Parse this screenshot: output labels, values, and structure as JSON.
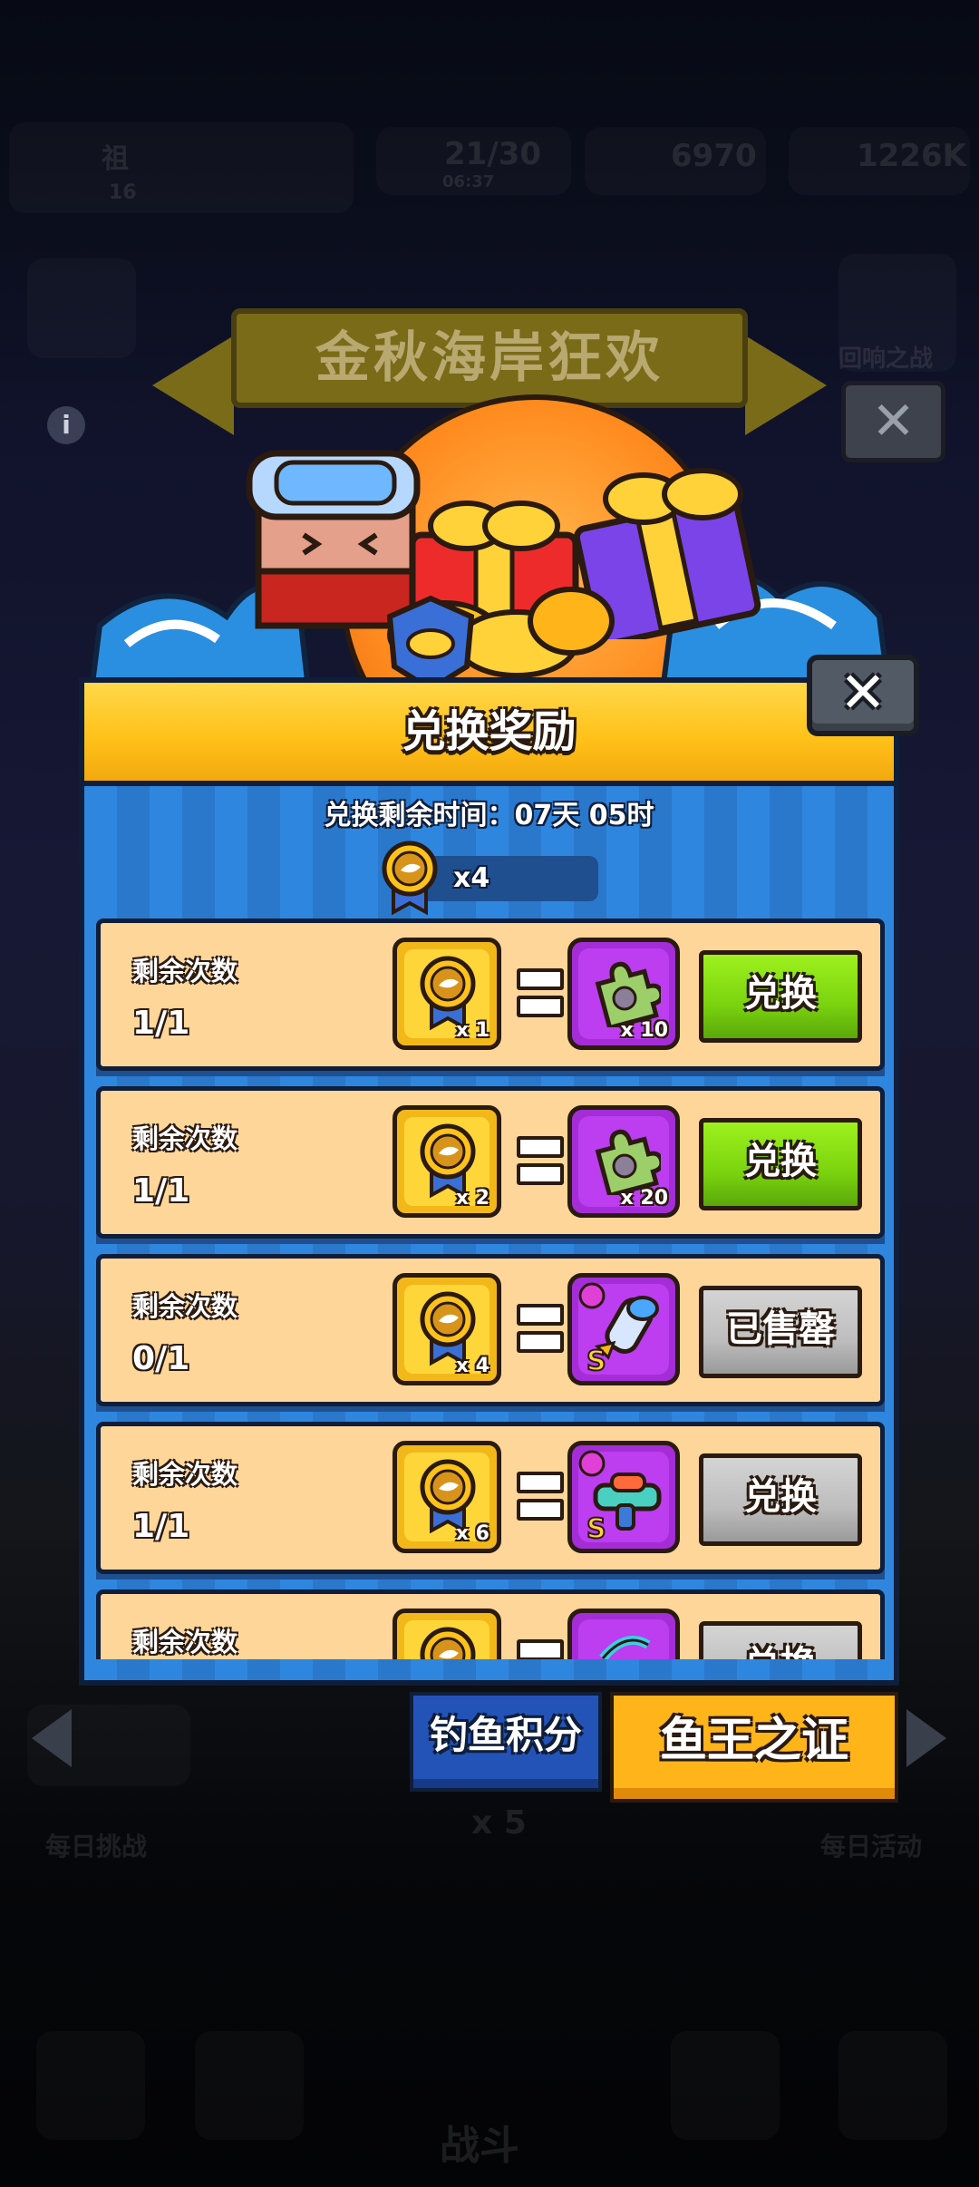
{
  "background": {
    "top_bar": {
      "player_name": "祖",
      "level": "16",
      "energy": "21/30",
      "energy_timer": "06:37",
      "coins": "6970",
      "gems": "1226K"
    },
    "event_banner_title": "金秋海岸狂欢",
    "side_label_right": "回响之战",
    "bottom_labels": {
      "left": "每日挑战",
      "right": "每日活动",
      "center_count": "x 5",
      "fight": "战斗"
    }
  },
  "modal": {
    "title": "兑换奖励",
    "timer_label": "兑换剩余时间：07天 05时",
    "balance": "x4",
    "close_icon": "close-icon",
    "rows": [
      {
        "label": "剩余次数",
        "count": "1/1",
        "cost_qty": "x 1",
        "reward_qty": "x 10",
        "reward_icon": "puzzle-piece-icon",
        "action": "兑换",
        "state": "available"
      },
      {
        "label": "剩余次数",
        "count": "1/1",
        "cost_qty": "x 2",
        "reward_qty": "x 20",
        "reward_icon": "puzzle-piece-icon",
        "action": "兑换",
        "state": "available"
      },
      {
        "label": "剩余次数",
        "count": "0/1",
        "cost_qty": "x 4",
        "reward_qty": "",
        "reward_icon": "rocket-gauntlet-icon",
        "action": "已售罄",
        "state": "sold-out"
      },
      {
        "label": "剩余次数",
        "count": "1/1",
        "cost_qty": "x 6",
        "reward_qty": "",
        "reward_icon": "water-gun-icon",
        "action": "兑换",
        "state": "disabled"
      },
      {
        "label": "剩余次数",
        "count": "",
        "cost_qty": "",
        "reward_qty": "",
        "reward_icon": "bow-icon",
        "action": "兑换",
        "state": "disabled"
      }
    ]
  },
  "tabs": {
    "points": "钓鱼积分",
    "certificate": "鱼王之证"
  },
  "colors": {
    "modal_blue": "#2c7fd6",
    "header_yellow": "#ffc21a",
    "row_bg": "#ffd69a",
    "exchange_green": "#7ad30e",
    "disabled_gray": "#bdbdbd",
    "reward_purple": "#a52dd8"
  }
}
